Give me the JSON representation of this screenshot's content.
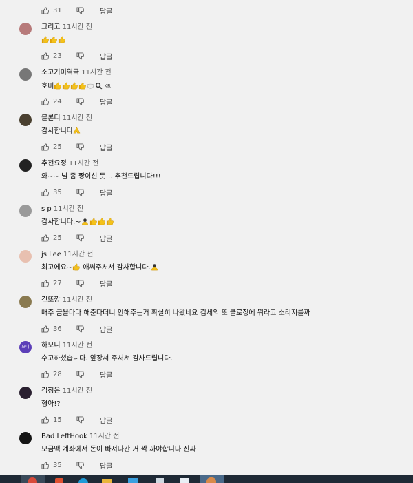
{
  "top_actions": {
    "likes": "31",
    "reply": "답글"
  },
  "comments": [
    {
      "author": "그리고",
      "time": "11시간 전",
      "text": "",
      "emojis": [
        "thumbs-up",
        "thumbs-up",
        "thumbs-up"
      ],
      "likes": "23",
      "reply": "답글",
      "avatar_color": "#b77a7a"
    },
    {
      "author": "소고기미역국",
      "time": "11시간 전",
      "text": "호미",
      "emojis": [
        "thumbs-up",
        "thumbs-up",
        "thumbs-up",
        "thumbs-up",
        "bowl",
        "magnifier"
      ],
      "suffix": "KR",
      "likes": "24",
      "reply": "답글",
      "avatar_color": "#777777"
    },
    {
      "author": "블론디",
      "time": "11시간 전",
      "text": "감사합니다",
      "emojis": [
        "pray"
      ],
      "likes": "25",
      "reply": "답글",
      "avatar_color": "#4a4030"
    },
    {
      "author": "추천요정",
      "time": "11시간 전",
      "text": "와~~  님 좀 짱이신 듯...  추천드립니다!!!",
      "emojis": [],
      "likes": "35",
      "reply": "답글",
      "avatar_color": "#222222"
    },
    {
      "author": "s p",
      "time": "11시간 전",
      "text": "감사합니다.~",
      "emojis": [
        "bow",
        "thumbs-up",
        "thumbs-up",
        "thumbs-up"
      ],
      "likes": "25",
      "reply": "답글",
      "avatar_color": "#9a9a9a"
    },
    {
      "author": "js Lee",
      "time": "11시간 전",
      "text": "최고에요~",
      "emojis": [
        "thumbs-up"
      ],
      "text2": " 애써주셔서 감사합니다.",
      "emojis2": [
        "bow"
      ],
      "likes": "27",
      "reply": "답글",
      "avatar_color": "#e8c0b0"
    },
    {
      "author": "긴또깡",
      "time": "11시간 전",
      "text": "매주 금욜마다 해준다더니 안해주는거 확실히 나왔네요 김세의 또 클로징에 뭐라고 소리지를까",
      "emojis": [],
      "likes": "36",
      "reply": "답글",
      "avatar_color": "#8a7a50"
    },
    {
      "author": "하모니",
      "time": "11시간 전",
      "text": "수고하셨습니다. 앞장서 주셔서 감사드립니다.",
      "emojis": [],
      "likes": "28",
      "reply": "답글",
      "avatar_color": "#5c3fb8",
      "avatar_text": "모니"
    },
    {
      "author": "김정은",
      "time": "11시간 전",
      "text": "형아!?",
      "emojis": [],
      "likes": "15",
      "reply": "답글",
      "avatar_color": "#2a2030"
    },
    {
      "author": "Bad LeftHook",
      "time": "11시간 전",
      "text": "모금액 계좌에서 돈이 빠져나간 거 싹 까야합니다 진짜",
      "emojis": [],
      "likes": "35",
      "reply": "답글",
      "avatar_color": "#151515"
    }
  ],
  "colors": {
    "background": "#f1f1f1",
    "thumb": "#f4b400",
    "taskbar": "#1f2a36"
  }
}
